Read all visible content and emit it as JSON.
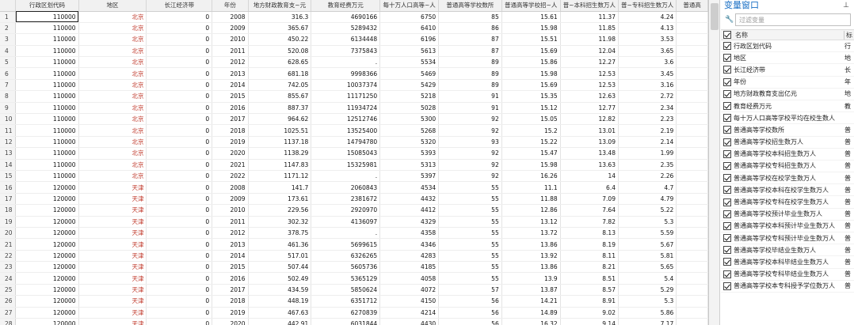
{
  "grid": {
    "columns": [
      {
        "label": "行政区划代码",
        "width": 80
      },
      {
        "label": "地区",
        "width": 88
      },
      {
        "label": "长江经济带",
        "width": 84
      },
      {
        "label": "年份",
        "width": 46
      },
      {
        "label": "地方财政教育支~元",
        "width": 80
      },
      {
        "label": "教育经费万元",
        "width": 88
      },
      {
        "label": "每十万人口高等~人",
        "width": 74
      },
      {
        "label": "普通高等学校数所",
        "width": 80
      },
      {
        "label": "普通高等学校招~人",
        "width": 74
      },
      {
        "label": "普~本科招生数万人",
        "width": 72
      },
      {
        "label": "普~专科招生数万人",
        "width": 72
      },
      {
        "label": "普通高",
        "width": 40
      }
    ],
    "rows": [
      {
        "n": "1",
        "c": [
          "110000",
          "北京",
          "0",
          "2008",
          "316.3",
          "4690166",
          "6750",
          "85",
          "15.61",
          "11.37",
          "4.24",
          ""
        ]
      },
      {
        "n": "2",
        "c": [
          "110000",
          "北京",
          "0",
          "2009",
          "365.67",
          "5289432",
          "6410",
          "86",
          "15.98",
          "11.85",
          "4.13",
          ""
        ]
      },
      {
        "n": "3",
        "c": [
          "110000",
          "北京",
          "0",
          "2010",
          "450.22",
          "6134448",
          "6196",
          "87",
          "15.51",
          "11.98",
          "3.53",
          ""
        ]
      },
      {
        "n": "4",
        "c": [
          "110000",
          "北京",
          "0",
          "2011",
          "520.08",
          "7375843",
          "5613",
          "87",
          "15.69",
          "12.04",
          "3.65",
          ""
        ]
      },
      {
        "n": "5",
        "c": [
          "110000",
          "北京",
          "0",
          "2012",
          "628.65",
          ".",
          "5534",
          "89",
          "15.86",
          "12.27",
          "3.6",
          ""
        ]
      },
      {
        "n": "6",
        "c": [
          "110000",
          "北京",
          "0",
          "2013",
          "681.18",
          "9998366",
          "5469",
          "89",
          "15.98",
          "12.53",
          "3.45",
          ""
        ]
      },
      {
        "n": "7",
        "c": [
          "110000",
          "北京",
          "0",
          "2014",
          "742.05",
          "10037374",
          "5429",
          "89",
          "15.69",
          "12.53",
          "3.16",
          ""
        ]
      },
      {
        "n": "8",
        "c": [
          "110000",
          "北京",
          "0",
          "2015",
          "855.67",
          "11171250",
          "5218",
          "91",
          "15.35",
          "12.63",
          "2.72",
          ""
        ]
      },
      {
        "n": "9",
        "c": [
          "110000",
          "北京",
          "0",
          "2016",
          "887.37",
          "11934724",
          "5028",
          "91",
          "15.12",
          "12.77",
          "2.34",
          ""
        ]
      },
      {
        "n": "10",
        "c": [
          "110000",
          "北京",
          "0",
          "2017",
          "964.62",
          "12512746",
          "5300",
          "92",
          "15.05",
          "12.82",
          "2.23",
          ""
        ]
      },
      {
        "n": "11",
        "c": [
          "110000",
          "北京",
          "0",
          "2018",
          "1025.51",
          "13525400",
          "5268",
          "92",
          "15.2",
          "13.01",
          "2.19",
          ""
        ]
      },
      {
        "n": "12",
        "c": [
          "110000",
          "北京",
          "0",
          "2019",
          "1137.18",
          "14794780",
          "5320",
          "93",
          "15.22",
          "13.09",
          "2.14",
          ""
        ]
      },
      {
        "n": "13",
        "c": [
          "110000",
          "北京",
          "0",
          "2020",
          "1138.29",
          "15085043",
          "5393",
          "92",
          "15.47",
          "13.48",
          "1.99",
          ""
        ]
      },
      {
        "n": "14",
        "c": [
          "110000",
          "北京",
          "0",
          "2021",
          "1147.83",
          "15325981",
          "5313",
          "92",
          "15.98",
          "13.63",
          "2.35",
          ""
        ]
      },
      {
        "n": "15",
        "c": [
          "110000",
          "北京",
          "0",
          "2022",
          "1171.12",
          ".",
          "5397",
          "92",
          "16.26",
          "14",
          "2.26",
          ""
        ]
      },
      {
        "n": "16",
        "c": [
          "120000",
          "天津",
          "0",
          "2008",
          "141.7",
          "2060843",
          "4534",
          "55",
          "11.1",
          "6.4",
          "4.7",
          ""
        ]
      },
      {
        "n": "17",
        "c": [
          "120000",
          "天津",
          "0",
          "2009",
          "173.61",
          "2381672",
          "4432",
          "55",
          "11.88",
          "7.09",
          "4.79",
          ""
        ]
      },
      {
        "n": "18",
        "c": [
          "120000",
          "天津",
          "0",
          "2010",
          "229.56",
          "2920970",
          "4412",
          "55",
          "12.86",
          "7.64",
          "5.22",
          ""
        ]
      },
      {
        "n": "19",
        "c": [
          "120000",
          "天津",
          "0",
          "2011",
          "302.32",
          "4136097",
          "4329",
          "55",
          "13.12",
          "7.82",
          "5.3",
          ""
        ]
      },
      {
        "n": "20",
        "c": [
          "120000",
          "天津",
          "0",
          "2012",
          "378.75",
          ".",
          "4358",
          "55",
          "13.72",
          "8.13",
          "5.59",
          ""
        ]
      },
      {
        "n": "21",
        "c": [
          "120000",
          "天津",
          "0",
          "2013",
          "461.36",
          "5699615",
          "4346",
          "55",
          "13.86",
          "8.19",
          "5.67",
          ""
        ]
      },
      {
        "n": "22",
        "c": [
          "120000",
          "天津",
          "0",
          "2014",
          "517.01",
          "6326265",
          "4283",
          "55",
          "13.92",
          "8.11",
          "5.81",
          ""
        ]
      },
      {
        "n": "23",
        "c": [
          "120000",
          "天津",
          "0",
          "2015",
          "507.44",
          "5605736",
          "4185",
          "55",
          "13.86",
          "8.21",
          "5.65",
          ""
        ]
      },
      {
        "n": "24",
        "c": [
          "120000",
          "天津",
          "0",
          "2016",
          "502.49",
          "5365129",
          "4058",
          "55",
          "13.9",
          "8.51",
          "5.4",
          ""
        ]
      },
      {
        "n": "25",
        "c": [
          "120000",
          "天津",
          "0",
          "2017",
          "434.59",
          "5850624",
          "4072",
          "57",
          "13.87",
          "8.57",
          "5.29",
          ""
        ]
      },
      {
        "n": "26",
        "c": [
          "120000",
          "天津",
          "0",
          "2018",
          "448.19",
          "6351712",
          "4150",
          "56",
          "14.21",
          "8.91",
          "5.3",
          ""
        ]
      },
      {
        "n": "27",
        "c": [
          "120000",
          "天津",
          "0",
          "2019",
          "467.63",
          "6270839",
          "4214",
          "56",
          "14.89",
          "9.02",
          "5.86",
          ""
        ]
      },
      {
        "n": "28",
        "c": [
          "120000",
          "天津",
          "0",
          "2020",
          "442.91",
          "6031844",
          "4430",
          "56",
          "16.32",
          "9.14",
          "7.17",
          ""
        ]
      }
    ]
  },
  "var_panel": {
    "title": "变量窗口",
    "pin_icon": "pin-icon",
    "search_placeholder": "过滤变量",
    "header_name": "名称",
    "header_label": "标",
    "variables": [
      {
        "name": "行政区划代码",
        "label": "行"
      },
      {
        "name": "地区",
        "label": "地"
      },
      {
        "name": "长江经济带",
        "label": "长"
      },
      {
        "name": "年份",
        "label": "年"
      },
      {
        "name": "地方财政教育支出亿元",
        "label": "地"
      },
      {
        "name": "教育经费万元",
        "label": "教"
      },
      {
        "name": "每十万人口高等学校平均在校生数人",
        "label": ""
      },
      {
        "name": "普通高等学校数所",
        "label": "普"
      },
      {
        "name": "普通高等学校招生数万人",
        "label": "普"
      },
      {
        "name": "普通高等学校本科招生数万人",
        "label": "普"
      },
      {
        "name": "普通高等学校专科招生数万人",
        "label": "普"
      },
      {
        "name": "普通高等学校在校学生数万人",
        "label": "普"
      },
      {
        "name": "普通高等学校本科在校学生数万人",
        "label": "普"
      },
      {
        "name": "普通高等学校专科在校学生数万人",
        "label": "普"
      },
      {
        "name": "普通高等学校预计毕业生数万人",
        "label": "普"
      },
      {
        "name": "普通高等学校本科预计毕业生数万人",
        "label": "普"
      },
      {
        "name": "普通高等学校专科预计毕业生数万人",
        "label": "普"
      },
      {
        "name": "普通高等学校毕结业生数万人",
        "label": "普"
      },
      {
        "name": "普通高等学校本科毕结业生数万人",
        "label": "普"
      },
      {
        "name": "普通高等学校专科毕结业生数万人",
        "label": "普"
      },
      {
        "name": "普通高等学校本专科授予学位数万人",
        "label": "普"
      }
    ]
  },
  "colors": {
    "region_text": "#c0392b",
    "panel_title": "#1a6fc4"
  }
}
